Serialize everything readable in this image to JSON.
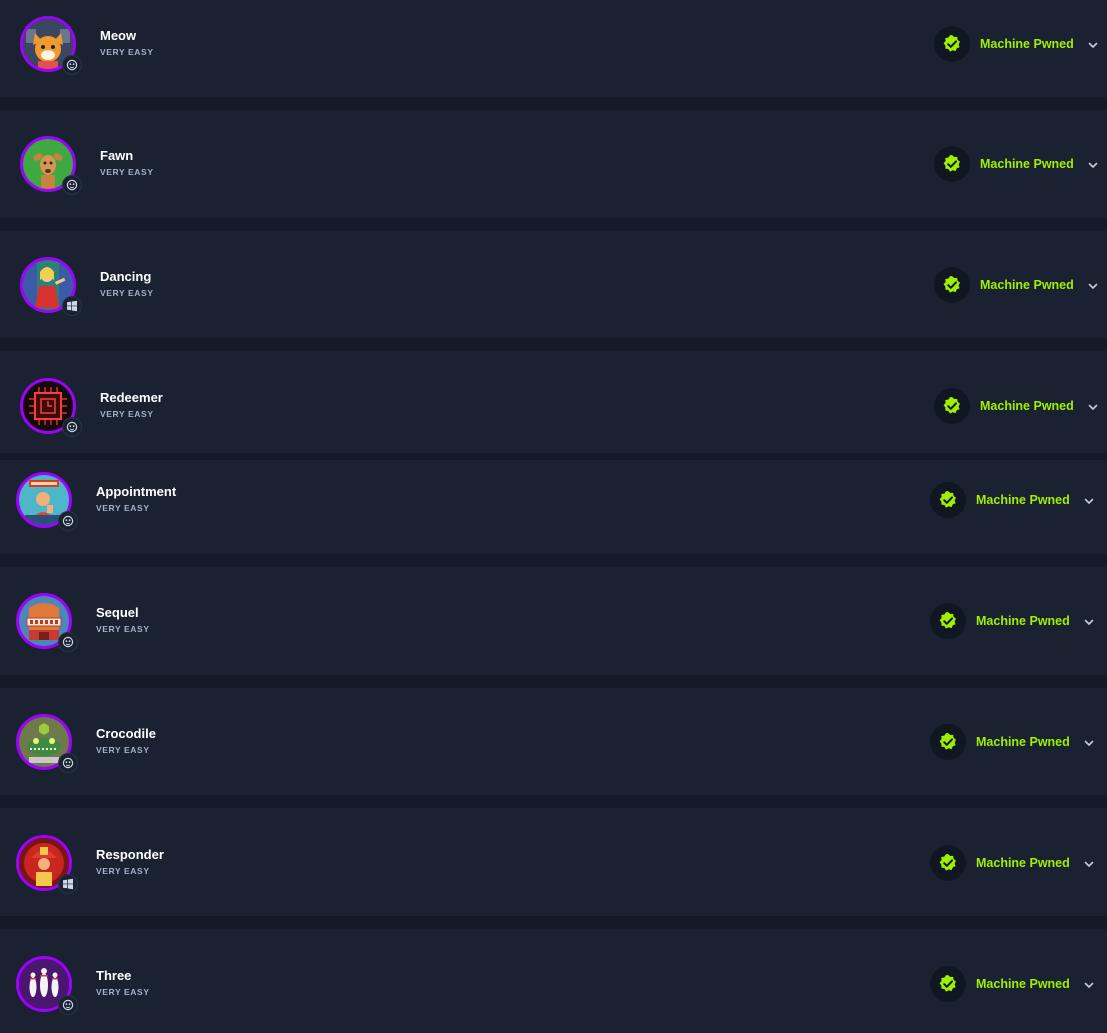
{
  "theme": {
    "accent": "#9fef00",
    "ring": "#9f00ff",
    "card": "#1a2232",
    "background": "#141a27"
  },
  "machines": [
    {
      "name": "Meow",
      "difficulty": "VERY EASY",
      "status": "Machine Pwned",
      "os": "linux-icon",
      "avatar": "cat-avatar-icon"
    },
    {
      "name": "Fawn",
      "difficulty": "VERY EASY",
      "status": "Machine Pwned",
      "os": "linux-icon",
      "avatar": "fawn-avatar-icon"
    },
    {
      "name": "Dancing",
      "difficulty": "VERY EASY",
      "status": "Machine Pwned",
      "os": "windows-icon",
      "avatar": "dancer-avatar-icon"
    },
    {
      "name": "Redeemer",
      "difficulty": "VERY EASY",
      "status": "Machine Pwned",
      "os": "linux-icon",
      "avatar": "chip-avatar-icon"
    },
    {
      "name": "Appointment",
      "difficulty": "VERY EASY",
      "status": "Machine Pwned",
      "os": "linux-icon",
      "avatar": "waiting-man-avatar-icon"
    },
    {
      "name": "Sequel",
      "difficulty": "VERY EASY",
      "status": "Machine Pwned",
      "os": "linux-icon",
      "avatar": "theater-avatar-icon"
    },
    {
      "name": "Crocodile",
      "difficulty": "VERY EASY",
      "status": "Machine Pwned",
      "os": "linux-icon",
      "avatar": "crocodile-avatar-icon"
    },
    {
      "name": "Responder",
      "difficulty": "VERY EASY",
      "status": "Machine Pwned",
      "os": "windows-icon",
      "avatar": "firefighter-avatar-icon"
    },
    {
      "name": "Three",
      "difficulty": "VERY EASY",
      "status": "Machine Pwned",
      "os": "linux-icon",
      "avatar": "bowling-pins-avatar-icon"
    }
  ]
}
